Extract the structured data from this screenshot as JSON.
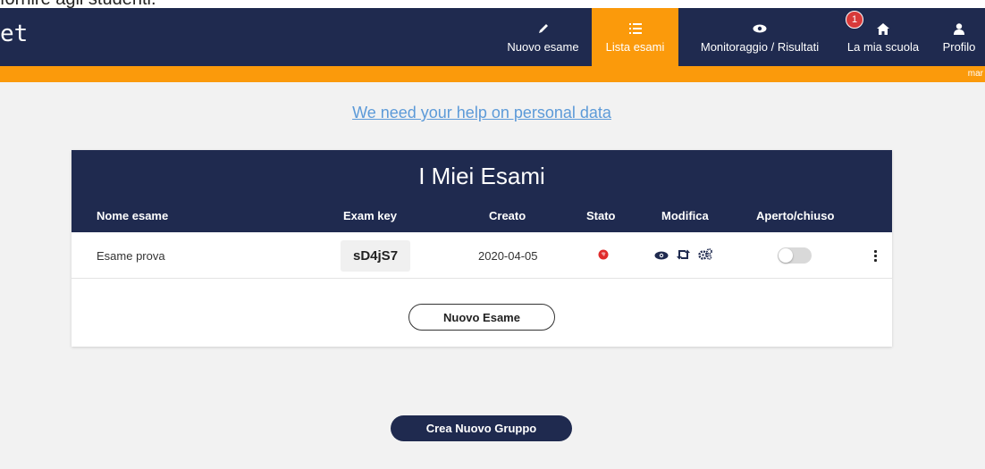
{
  "top_strip_text": "fornire agli studenti.",
  "brand": "et",
  "nav": {
    "items": [
      {
        "label": "Nuovo esame",
        "icon": "pencil-icon"
      },
      {
        "label": "Lista esami",
        "icon": "list-icon",
        "active": true
      },
      {
        "label": "Monitoraggio / Risultati",
        "icon": "eye-icon"
      },
      {
        "label": "La mia scuola",
        "icon": "home-icon",
        "badge": "1"
      },
      {
        "label": "Profilo",
        "icon": "user-icon"
      }
    ]
  },
  "orange_bar_text": "mar",
  "help_link": "We need your help on personal data",
  "card": {
    "title": "I Miei Esami",
    "columns": [
      "Nome esame",
      "Exam key",
      "Creato",
      "Stato",
      "Modifica",
      "Aperto/chiuso"
    ],
    "rows": [
      {
        "name": "Esame prova",
        "key": "sD4jS7",
        "created": "2020-04-05",
        "status": "closed",
        "open": false
      }
    ],
    "new_exam_button": "Nuovo Esame"
  },
  "new_group_button": "Crea Nuovo Gruppo",
  "colors": {
    "navy": "#1f2a4f",
    "orange": "#fb9a0b",
    "link": "#5c9ad8",
    "status_red": "#e02b2b"
  }
}
